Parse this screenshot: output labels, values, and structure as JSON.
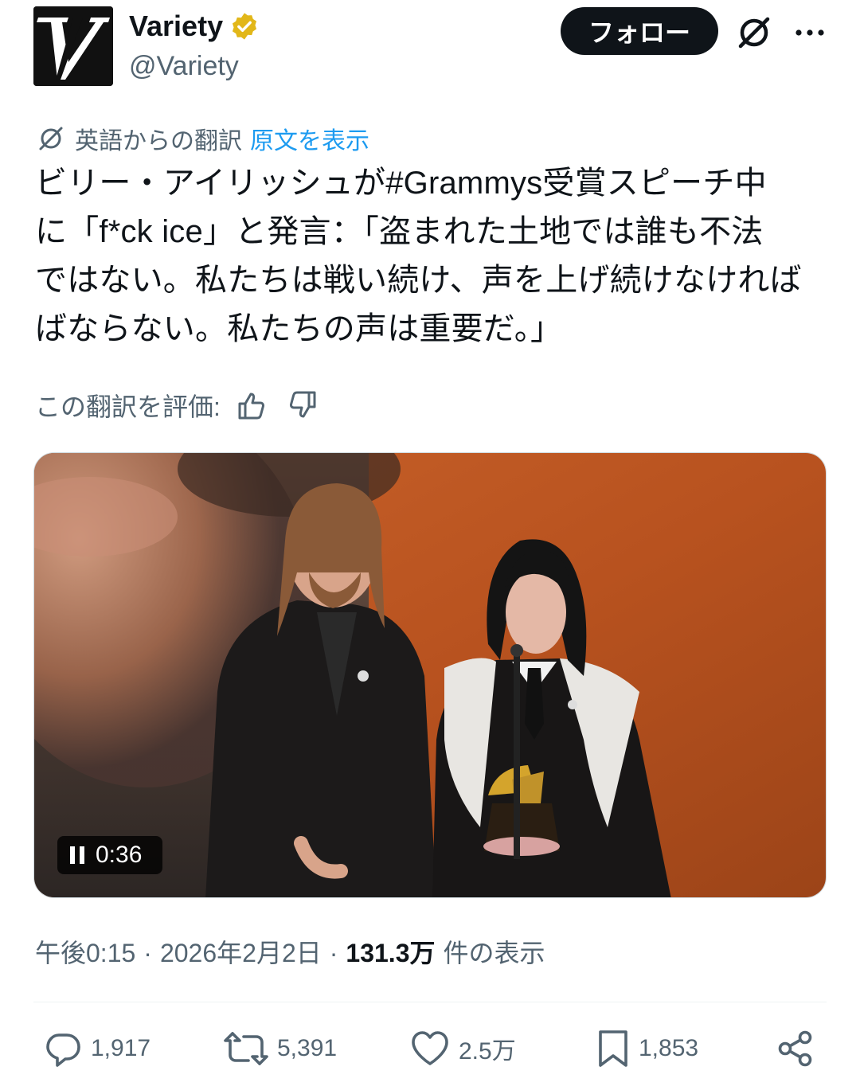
{
  "header": {
    "display_name": "Variety",
    "handle": "@Variety",
    "follow_label": "フォロー",
    "verified_color": "#e2b719",
    "avatar_icon": "variety-logo",
    "grok_icon": "grok-icon",
    "more_icon": "more-icon"
  },
  "translation": {
    "label": "英語からの翻訳",
    "show_original": "原文を表示"
  },
  "tweet": {
    "line1": "ビリー・アイリッシュが#Grammys受賞スピーチ中",
    "line2": "に「f*ck ice」と発言：「盗まれた土地では誰も不法",
    "line3": "ではない。私たちは戦い続け、声を上げ続けなければ",
    "line4": "ばならない。私たちの声は重要だ。」"
  },
  "rating": {
    "label": "この翻訳を評価:"
  },
  "media": {
    "video_time": "0:36"
  },
  "meta": {
    "time": "午後0:15",
    "sep": "·",
    "date": "2026年2月2日",
    "views_count": "131.3万",
    "views_label": "件の表示"
  },
  "actions": {
    "replies": "1,917",
    "reposts": "5,391",
    "likes": "2.5万",
    "bookmarks": "1,853"
  },
  "colors": {
    "link": "#1d9bf0",
    "muted": "#536471",
    "text": "#0f1419"
  }
}
